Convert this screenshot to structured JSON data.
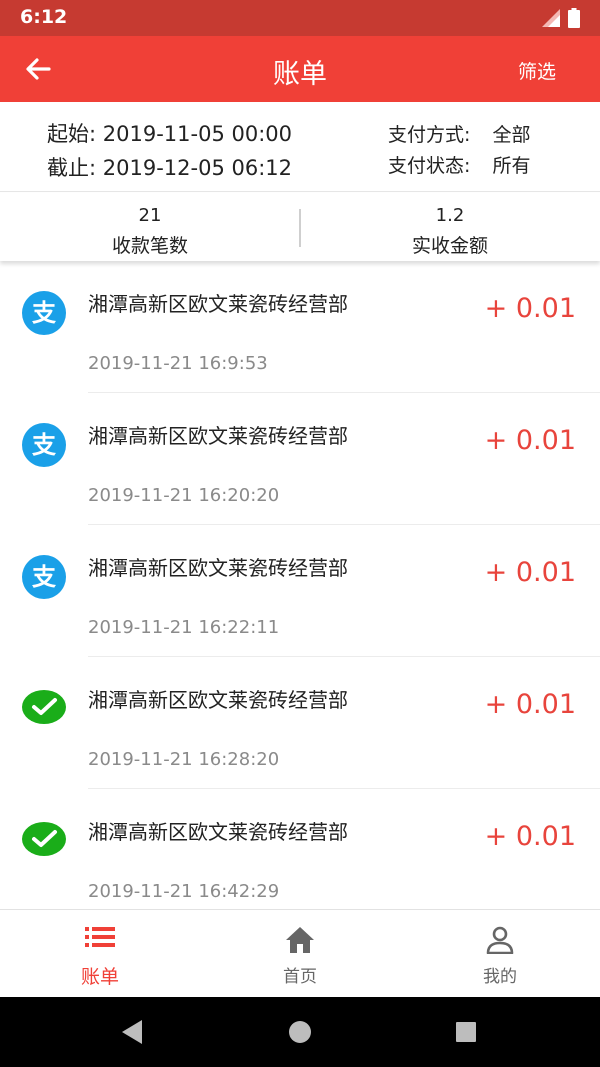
{
  "status_bar": {
    "time": "6:12"
  },
  "app_bar": {
    "title": "账单",
    "filter_label": "筛选"
  },
  "date_range": {
    "start_label": "起始:",
    "start_value": "2019-11-05 00:00",
    "end_label": "截止:",
    "end_value": "2019-12-05 06:12"
  },
  "payment_filters": {
    "method_label": "支付方式:",
    "method_value": "全部",
    "status_label": "支付状态:",
    "status_value": "所有"
  },
  "summary": {
    "count_value": "21",
    "count_label": "收款笔数",
    "amount_value": "1.2",
    "amount_label": "实收金额"
  },
  "transactions": [
    {
      "channel_icon": "alipay-icon",
      "merchant": "湘潭高新区欧文莱瓷砖经营部",
      "time": "2019-11-21 16:9:53",
      "amount": "+ 0.01"
    },
    {
      "channel_icon": "alipay-icon",
      "merchant": "湘潭高新区欧文莱瓷砖经营部",
      "time": "2019-11-21 16:20:20",
      "amount": "+ 0.01"
    },
    {
      "channel_icon": "alipay-icon",
      "merchant": "湘潭高新区欧文莱瓷砖经营部",
      "time": "2019-11-21 16:22:11",
      "amount": "+ 0.01"
    },
    {
      "channel_icon": "wechat-pay-icon",
      "merchant": "湘潭高新区欧文莱瓷砖经营部",
      "time": "2019-11-21 16:28:20",
      "amount": "+ 0.01"
    },
    {
      "channel_icon": "wechat-pay-icon",
      "merchant": "湘潭高新区欧文莱瓷砖经营部",
      "time": "2019-11-21 16:42:29",
      "amount": "+ 0.01"
    }
  ],
  "bottom_nav": [
    {
      "icon": "list-icon",
      "label": "账单",
      "active": true
    },
    {
      "icon": "home-icon",
      "label": "首页",
      "active": false
    },
    {
      "icon": "person-icon",
      "label": "我的",
      "active": false
    }
  ],
  "colors": {
    "brand": "#f04037",
    "status_bar": "#c63a31",
    "amount": "#e8443c",
    "alipay": "#1aa0e8",
    "wechat": "#1aad19"
  }
}
